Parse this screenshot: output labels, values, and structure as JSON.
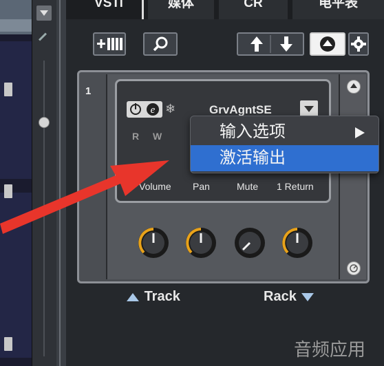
{
  "tabs": [
    {
      "label": "VSTi"
    },
    {
      "label": "媒体"
    },
    {
      "label": "CR"
    },
    {
      "label": "电平表"
    }
  ],
  "toolbar": {
    "instrument_icon": "add-instrument-icon",
    "search_icon": "search-icon",
    "up_icon": "arrow-up-icon",
    "down_icon": "arrow-down-icon",
    "collapse_icon": "collapse-all-icon",
    "settings_icon": "gear-icon"
  },
  "rack": {
    "slot_number": "1",
    "plugin_name": "GrvAgntSE",
    "r_label": "R",
    "w_label": "W",
    "params": {
      "volume": "Volume",
      "pan": "Pan",
      "mute": "Mute",
      "return": "1 Return"
    }
  },
  "context_menu": {
    "items": [
      {
        "label": "输入选项",
        "has_submenu": true
      },
      {
        "label": "激活输出",
        "highlighted": true
      }
    ]
  },
  "footer": {
    "track_label": "Track",
    "rack_label": "Rack"
  },
  "watermark": "音频应用",
  "colors": {
    "highlight": "#2f6fd0",
    "knob_accent": "#e8a21a",
    "arrow": "#e8352b"
  }
}
